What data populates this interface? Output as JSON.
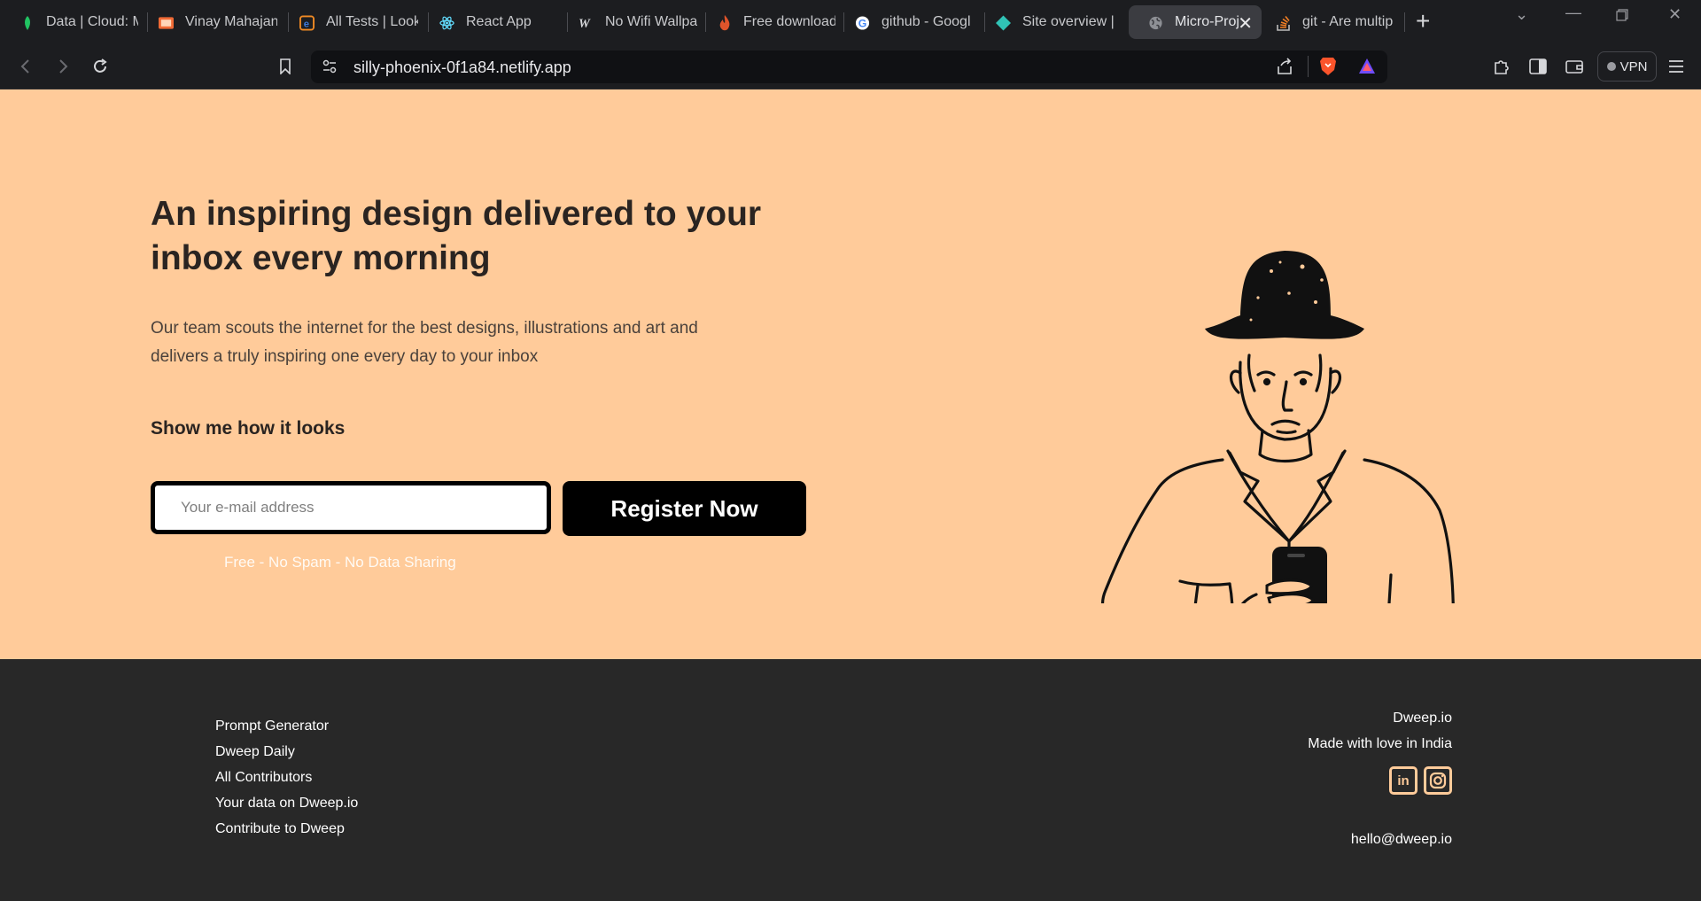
{
  "browser": {
    "tabs": [
      {
        "label": "Data | Cloud: M",
        "icon": "leaf-icon",
        "color": "#21c462",
        "active": false
      },
      {
        "label": "Vinay Mahajan",
        "icon": "slides-icon",
        "color": "#f06a35",
        "active": false
      },
      {
        "label": "All Tests | Look",
        "icon": "e-icon",
        "color": "#f08a24",
        "active": false
      },
      {
        "label": "React App",
        "icon": "react-icon",
        "color": "#61dafb",
        "active": false
      },
      {
        "label": "No Wifi Wallpa",
        "icon": "w-icon",
        "color": "#d6d7da",
        "active": false
      },
      {
        "label": "Free download",
        "icon": "flame-icon",
        "color": "#e0542b",
        "active": false
      },
      {
        "label": "github - Googl",
        "icon": "google-icon",
        "color": "#4285f4",
        "active": false
      },
      {
        "label": "Site overview |",
        "icon": "netlify-icon",
        "color": "#30c3b6",
        "active": false
      },
      {
        "label": "Micro-Proj",
        "icon": "globe-icon",
        "color": "#c8c9cc",
        "active": true
      },
      {
        "label": "git - Are multip",
        "icon": "stackoverflow-icon",
        "color": "#f48024",
        "active": false
      }
    ],
    "url": "silly-phoenix-0f1a84.netlify.app",
    "vpn_label": "VPN"
  },
  "hero": {
    "headline": "An inspiring design delivered to your inbox every morning",
    "subtext": "Our team scouts the internet for the best designs, illustrations and art and delivers a truly inspiring one every day to your inbox",
    "show_link": "Show me how it looks",
    "email_placeholder": "Your e-mail address",
    "register_label": "Register Now",
    "note": "Free - No Spam - No Data Sharing"
  },
  "footer": {
    "links": [
      "Prompt Generator",
      "Dweep Daily",
      "All Contributors",
      "Your data on Dweep.io",
      "Contribute to Dweep"
    ],
    "brand": "Dweep.io",
    "tagline": "Made with love in India",
    "socials": [
      {
        "name": "linkedin-icon",
        "glyph": "in"
      },
      {
        "name": "instagram-icon",
        "glyph": ""
      }
    ],
    "contact_email": "hello@dweep.io"
  },
  "colors": {
    "hero_bg": "#ffcb9a",
    "footer_bg": "#282828",
    "accent": "#ffcb9a",
    "button_bg": "#000000"
  }
}
